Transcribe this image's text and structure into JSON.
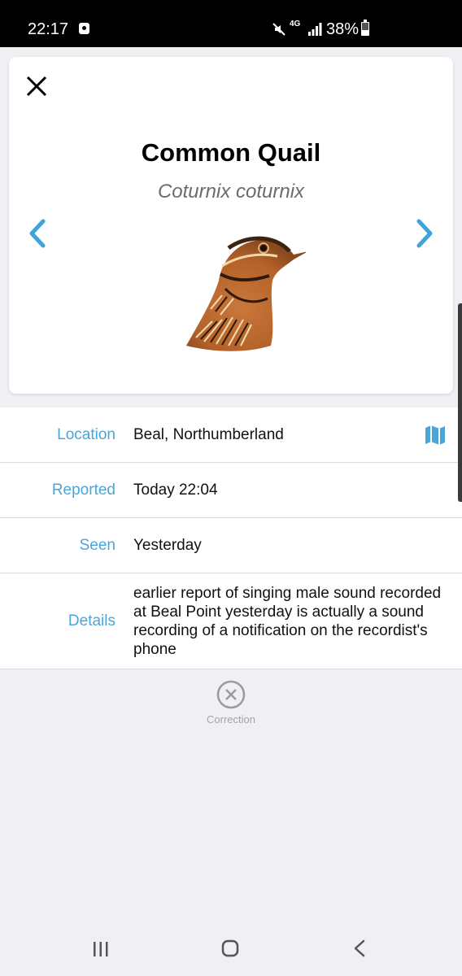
{
  "status_bar": {
    "time": "22:17",
    "network": "4G",
    "battery": "38%"
  },
  "species": {
    "common_name": "Common Quail",
    "scientific_name": "Coturnix coturnix"
  },
  "details": {
    "location_label": "Location",
    "location_value": "Beal, Northumberland",
    "reported_label": "Reported",
    "reported_value": "Today 22:04",
    "seen_label": "Seen",
    "seen_value": "Yesterday",
    "details_label": "Details",
    "details_value": "earlier report of singing male sound recorded at Beal Point yesterday is actually a sound recording of a notification on the recordist's phone"
  },
  "actions": {
    "correction_label": "Correction"
  },
  "icons": {
    "close": "close-icon",
    "prev": "chevron-left-icon",
    "next": "chevron-right-icon",
    "map": "map-icon",
    "correction": "circle-x-icon"
  },
  "colors": {
    "accent": "#4aa6d8",
    "background": "#efeff4",
    "status_bar": "#000000"
  }
}
